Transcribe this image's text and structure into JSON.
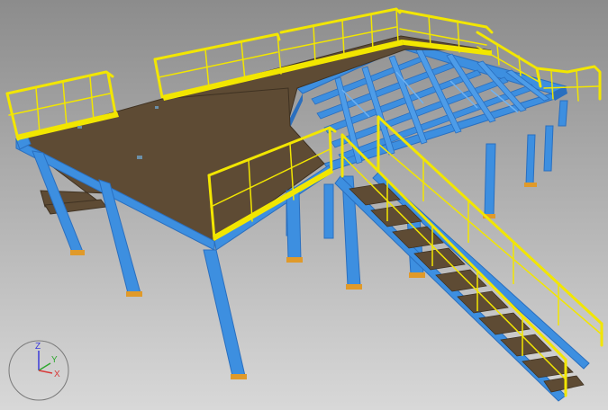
{
  "viewer": {
    "colors": {
      "background_top": "#8e8e8e",
      "background_bottom": "#d6d6d6",
      "steel_beam": "#3d8fe0",
      "steel_beam_dark": "#2a6fbf",
      "steel_beam_light": "#6fb2f2",
      "deck_plate": "#5e4b34",
      "deck_plate_edge": "#3f3222",
      "handrail": "#f2e600",
      "handrail_dark": "#b8ad00",
      "base_plate": "#e09a2a"
    }
  },
  "triad": {
    "z_label": "Z",
    "y_label": "Y",
    "x_label": "X",
    "colors": {
      "z": "#3a3ad8",
      "y": "#2fa82f",
      "x": "#d83a3a",
      "ring": "#7a7a7a"
    }
  }
}
